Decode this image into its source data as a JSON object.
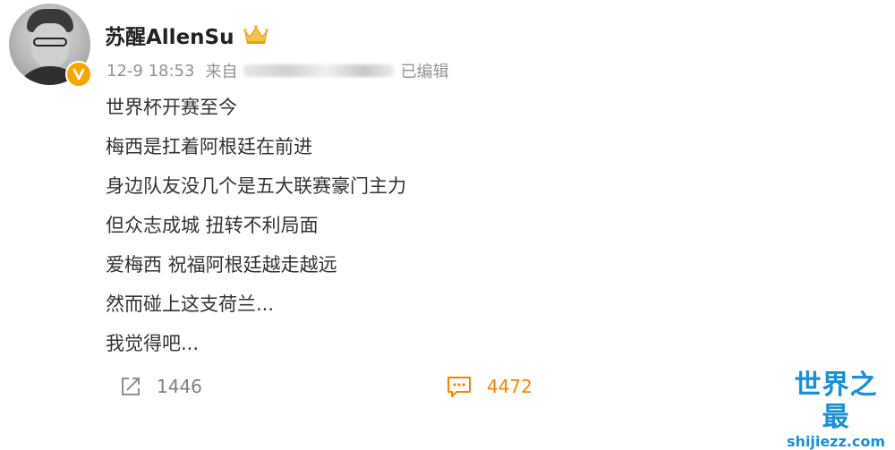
{
  "user": {
    "name": "苏醒AllenSu",
    "badge_icon": "crown-icon",
    "verified_icon": "verified-badge-icon"
  },
  "meta": {
    "timestamp": "12-9 18:53",
    "source_prefix": "来自",
    "edited_label": "已编辑"
  },
  "post": {
    "lines": [
      "世界杯开赛至今",
      "梅西是扛着阿根廷在前进",
      "身边队友没几个是五大联赛豪门主力",
      "但众志成城 扭转不利局面",
      "爱梅西 祝福阿根廷越走越远",
      "然而碰上这支荷兰...",
      "我觉得吧..."
    ]
  },
  "actions": {
    "repost_count": "1446",
    "comment_count": "4472",
    "repost_icon": "share-icon",
    "comment_icon": "comment-icon"
  },
  "watermark": {
    "title": "世界之最",
    "url": "shijiezz.com"
  },
  "colors": {
    "accent": "#ff8200",
    "text": "#333333",
    "meta": "#939393",
    "watermark": "#1e8fd6"
  }
}
